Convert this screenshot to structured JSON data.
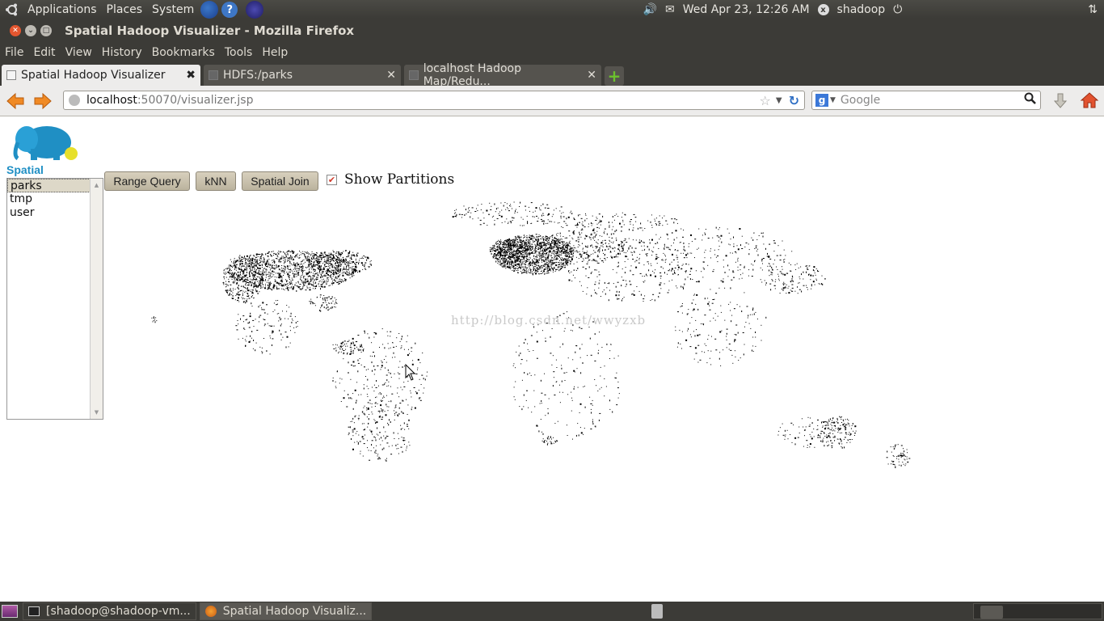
{
  "top_panel": {
    "menus": [
      "Applications",
      "Places",
      "System"
    ],
    "clock": "Wed Apr 23, 12:26 AM",
    "user": "shadoop"
  },
  "window": {
    "title": "Spatial Hadoop Visualizer - Mozilla Firefox"
  },
  "menubar": {
    "items": [
      "File",
      "Edit",
      "View",
      "History",
      "Bookmarks",
      "Tools",
      "Help"
    ]
  },
  "tabs": [
    {
      "label": "Spatial Hadoop Visualizer"
    },
    {
      "label": "HDFS:/parks"
    },
    {
      "label": "localhost Hadoop Map/Redu..."
    }
  ],
  "address": {
    "host": "localhost",
    "path": ":50070/visualizer.jsp"
  },
  "search": {
    "placeholder": "Google"
  },
  "app": {
    "logo_text": "Spatial Hadoop",
    "files": [
      "parks",
      "tmp",
      "user"
    ],
    "selected_file": "parks",
    "buttons": {
      "range_query": "Range Query",
      "knn": "kNN",
      "spatial_join": "Spatial Join"
    },
    "show_partitions_label": "Show Partitions",
    "show_partitions_checked": true,
    "watermark": "http://blog.csdn.net/wwyzxb"
  },
  "taskbar": {
    "items": [
      "[shadoop@shadoop-vm...",
      "Spatial Hadoop Visualiz..."
    ]
  }
}
